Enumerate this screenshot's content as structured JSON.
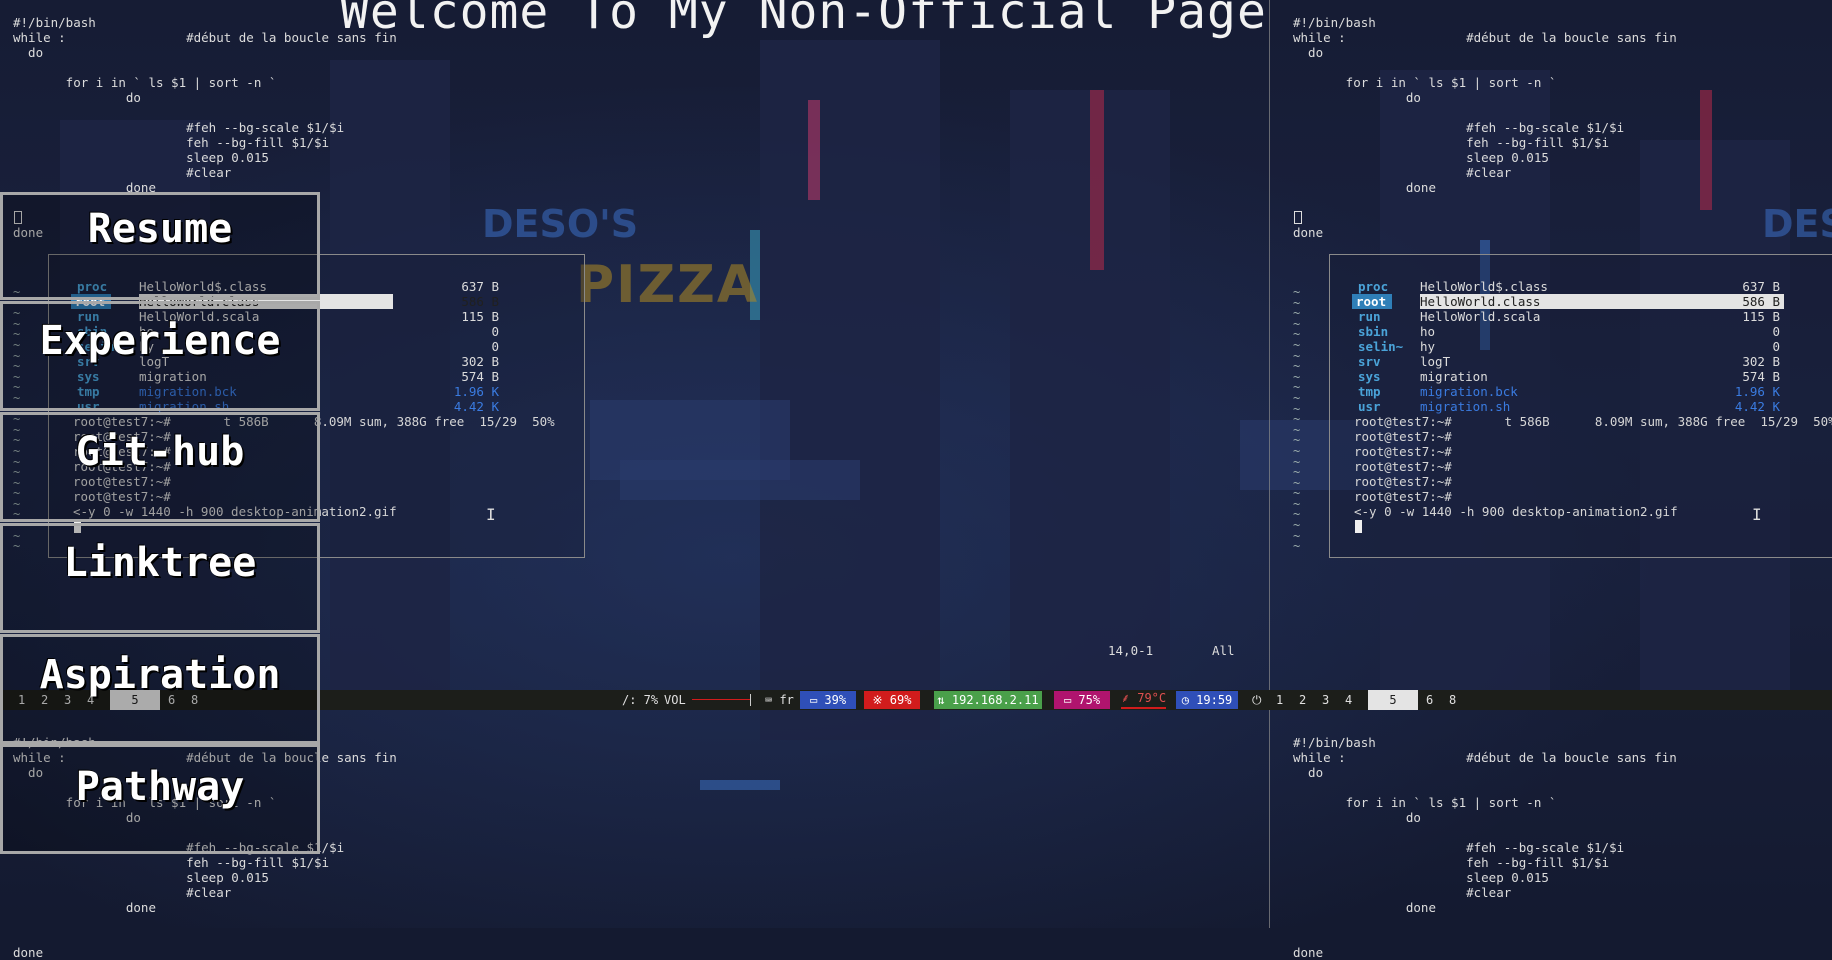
{
  "page_title": "Welcome To My Non-Official Page",
  "nav": [
    {
      "label": "Resume"
    },
    {
      "label": "Experience"
    },
    {
      "label": "Git-hub"
    },
    {
      "label": "Linktree"
    },
    {
      "label": "Aspiration"
    },
    {
      "label": "Pathway"
    }
  ],
  "script_lines": [
    "#!/bin/bash",
    "while :                #début de la boucle sans fin",
    "  do",
    "",
    "       for i in ` ls $1 | sort -n `",
    "               do",
    "",
    "                       #feh --bg-scale $1/$i",
    "                       feh --bg-fill $1/$i",
    "                       sleep 0.015",
    "                       #clear",
    "               done",
    "",
    "",
    "done"
  ],
  "ranger": {
    "rows": [
      {
        "dir": "proc",
        "name": "HelloWorld$.class",
        "size": "637 B"
      },
      {
        "dir": "root",
        "name": "HelloWorld.class",
        "size": "586 B",
        "selected": true
      },
      {
        "dir": "run",
        "name": "HelloWorld.scala",
        "size": "115 B"
      },
      {
        "dir": "sbin",
        "name": "ho",
        "size": "0"
      },
      {
        "dir": "selin~",
        "name": "hy",
        "size": "0"
      },
      {
        "dir": "srv",
        "name": "logT",
        "size": "302 B"
      },
      {
        "dir": "sys",
        "name": "migration",
        "size": "574 B"
      },
      {
        "dir": "tmp",
        "name": "migration.bck",
        "size": "1.96 K",
        "blue": true
      },
      {
        "dir": "usr",
        "name": "migration.sh",
        "size": "4.42 K",
        "blue": true
      }
    ],
    "status": "root@test7:~#       t 586B      8.09M sum, 388G free  15/29  50%",
    "prompts": [
      "root@test7:~#",
      "root@test7:~#",
      "root@test7:~#",
      "root@test7:~#",
      "root@test7:~#"
    ],
    "command": "<-y 0 -w 1440 -h 900 desktop-animation2.gif"
  },
  "vim_position": "14,0-1",
  "vim_scroll": "All",
  "statusbar": {
    "workspaces_left": [
      "1",
      "2",
      "3",
      "4",
      "5",
      "6",
      "8"
    ],
    "workspaces_right": [
      "1",
      "2",
      "3",
      "4",
      "5",
      "6",
      "8"
    ],
    "active_workspace": "5",
    "disk": "/: 7%",
    "vol_label": "VOL",
    "keyboard": "⌨ fr",
    "cpu": "▭ 39%",
    "mem": "※ 69%",
    "ip": "⇅ 192.168.2.11",
    "battery": "▭ 75%",
    "temp": "⸙ 79°C",
    "clock": "◷ 19:59",
    "power": "⏻",
    "colors": {
      "cpu": "#2f4fb8",
      "mem": "#d11c1c",
      "ip": "#4aa04a",
      "battery": "#b0146e",
      "temp_underline": "#d11c1c",
      "clock": "#2f4fb8"
    }
  }
}
